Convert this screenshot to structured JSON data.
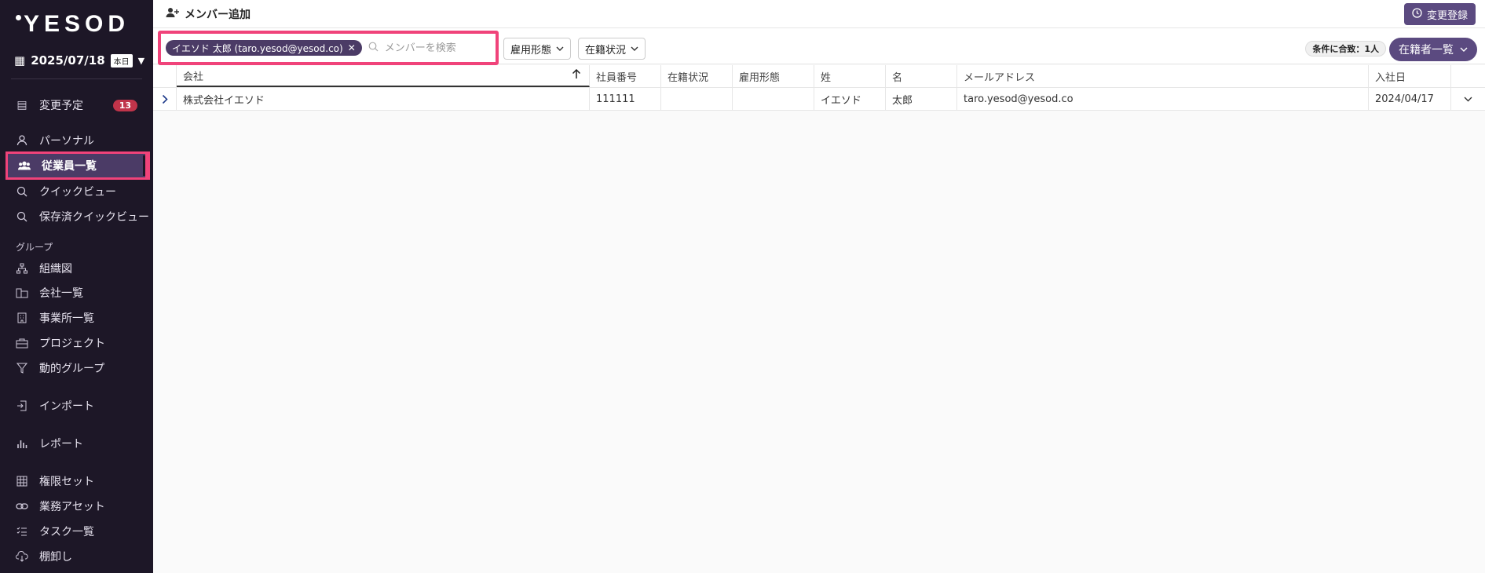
{
  "sidebar": {
    "logo": "YESOD",
    "date": "2025/07/18",
    "today_badge": "本日",
    "items": [
      {
        "label": "変更予定",
        "icon": "document-icon",
        "count": "13"
      },
      {
        "label": "パーソナル",
        "icon": "person-icon"
      },
      {
        "label": "従業員一覧",
        "icon": "users-icon"
      },
      {
        "label": "クイックビュー",
        "icon": "search-icon"
      },
      {
        "label": "保存済クイックビュー",
        "icon": "search-icon"
      },
      {
        "label": "組織図",
        "icon": "org-chart-icon"
      },
      {
        "label": "会社一覧",
        "icon": "company-icon"
      },
      {
        "label": "事業所一覧",
        "icon": "building-icon"
      },
      {
        "label": "プロジェクト",
        "icon": "briefcase-icon"
      },
      {
        "label": "動的グループ",
        "icon": "filter-icon"
      },
      {
        "label": "インポート",
        "icon": "import-icon"
      },
      {
        "label": "レポート",
        "icon": "bar-chart-icon"
      },
      {
        "label": "権限セット",
        "icon": "grid-icon"
      },
      {
        "label": "業務アセット",
        "icon": "link-icon"
      },
      {
        "label": "タスク一覧",
        "icon": "checklist-icon"
      },
      {
        "label": "棚卸し",
        "icon": "cloud-download-icon"
      }
    ],
    "group_label": "グループ"
  },
  "topbar": {
    "add_member": "メンバー追加",
    "change_register": "変更登録"
  },
  "filters": {
    "chip": "イエソド 太郎 (taro.yesod@yesod.co)",
    "search_placeholder": "メンバーを検索",
    "employment_type": "雇用形態",
    "status": "在籍状況",
    "match_count": "条件に合致：1人",
    "view": "在籍者一覧"
  },
  "table": {
    "headers": [
      "会社",
      "社員番号",
      "在籍状況",
      "雇用形態",
      "姓",
      "名",
      "メールアドレス",
      "入社日"
    ],
    "rows": [
      [
        "株式会社イエソド",
        "111111",
        "",
        "",
        "イエソド",
        "太郎",
        "taro.yesod@yesod.co",
        "2024/04/17"
      ]
    ]
  },
  "colors": {
    "sidebar_bg": "#1d1727",
    "accent": "#5b4a80",
    "highlight": "#f0437a",
    "badge": "#c0344a"
  }
}
